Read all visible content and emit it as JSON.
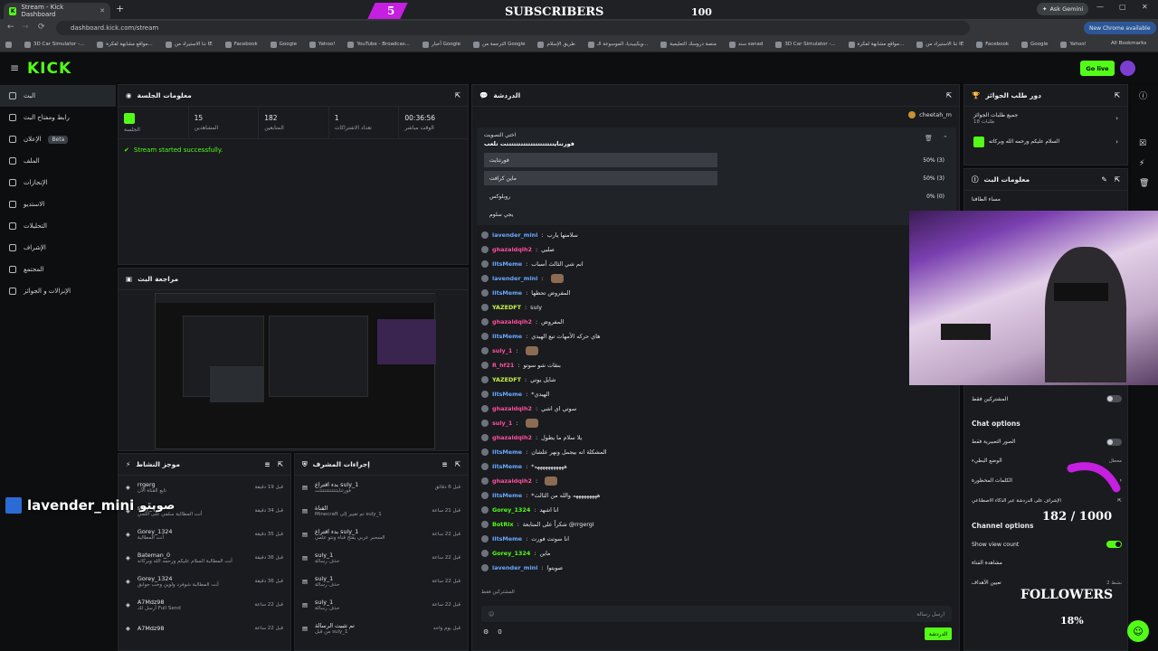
{
  "browser": {
    "tab_title": "Stream - Kick Dashboard",
    "new_tab": "+",
    "url": "dashboard.kick.com/stream",
    "ask_gemini": "Ask Gemini",
    "new_chrome": "New Chrome available",
    "all_bookmarks": "All Bookmarks",
    "bookmarks": [
      "3D Car Simulator -...",
      "مواقع مشابهة لفكرة...",
      "تنا الاستيراد من IE",
      "Facebook",
      "Google",
      "Yahoo!",
      "YouTube - Broadcas...",
      "أخبار Google",
      "الترجمة من Google",
      "طريق الإسلام",
      "ويكيبيديا، الموسوعة الـ...",
      "منصة دروسك التعليمية",
      "سند sanad",
      "3D Car Simulator -...",
      "مواقع مشابهة لفكرة...",
      "تنا الاستيراد من IE",
      "Facebook",
      "Google",
      "Yahoo!"
    ]
  },
  "overlay": {
    "subs_count": "5",
    "subs_label": "SUBSCRIBERS",
    "subs_goal": "100",
    "followers_count": "182 / 1000",
    "followers_label": "FOLLOWERS",
    "followers_pct": "18%",
    "highlight_user": "lavender_mini",
    "highlight_text": "صوبتو"
  },
  "header": {
    "logo": "KICK",
    "golive": "Go live"
  },
  "sidebar": {
    "items": [
      {
        "label": "البث",
        "badge": ""
      },
      {
        "label": "رابط ومفتاح البث",
        "badge": ""
      },
      {
        "label": "الإعلان",
        "badge": "Beta"
      },
      {
        "label": "الملف",
        "badge": ""
      },
      {
        "label": "الإنجازات",
        "badge": ""
      },
      {
        "label": "الاستديو",
        "badge": ""
      },
      {
        "label": "التحليلات",
        "badge": ""
      },
      {
        "label": "الإشراف",
        "badge": ""
      },
      {
        "label": "المجتمع",
        "badge": ""
      },
      {
        "label": "الإنزالات و الجوائز",
        "badge": ""
      }
    ]
  },
  "session": {
    "title": "معلومات الجلسة",
    "stats": [
      {
        "value": "",
        "label": "الجلسة"
      },
      {
        "value": "15",
        "label": "المشاهدين"
      },
      {
        "value": "182",
        "label": "المتابعين"
      },
      {
        "value": "1",
        "label": "تعداد الاشتراكات"
      },
      {
        "value": "00:36:56",
        "label": "الوقت مباشر"
      }
    ],
    "status": "Stream started successfully."
  },
  "preview": {
    "title": "مراجعة البث"
  },
  "activity": {
    "title": "موجز النشاط",
    "rows": [
      {
        "user": "rrgerg",
        "line1": "تابع القناة الآن",
        "time": "قبل 19 دقيقة"
      },
      {
        "user": "suly_1",
        "line1": "أنت المطالبة سلمي على اللجي",
        "time": "قبل 34 دقيقة"
      },
      {
        "user": "Gorey_1324",
        "line1": "أنت المطالبة",
        "time": "قبل 35 دقيقة"
      },
      {
        "user": "Bateman_0",
        "line1": "أنت المطالبة السلام عليكم ورحمه الله وبركاته",
        "time": "قبل 36 دقيقة"
      },
      {
        "user": "Gorey_1324",
        "line1": "أنت المطالبة شوفرد ولوين وحب حوابق",
        "time": "قبل 36 دقيقة"
      },
      {
        "user": "A7Mdz98",
        "line1": "أرسل لك Full Send",
        "time": "قبل 22 ساعة"
      },
      {
        "user": "A7Mdz98",
        "line1": "",
        "time": "قبل 22 ساعة"
      }
    ],
    "coin": "100"
  },
  "modlog": {
    "title": "إجراءات المشرف",
    "rows": [
      {
        "title": "بدء اقتراع suly_1",
        "sub": "فورتنايتتتتتتتتتتتتت",
        "time": "قبل 6 دقائق"
      },
      {
        "title": "القناة",
        "sub": "Minecraft تم تغيير إلى suly_1",
        "time": "قبل 21 ساعة"
      },
      {
        "title": "بدء اقتراع suly_1",
        "sub": "السحبر عربي يفتح قناة ونتو علمي",
        "time": "قبل 22 ساعة"
      },
      {
        "title": "suly_1",
        "sub": "حذف رسالة",
        "time": "قبل 22 ساعة"
      },
      {
        "title": "suly_1",
        "sub": "حذف رسالة",
        "time": "قبل 22 ساعة"
      },
      {
        "title": "suly_1",
        "sub": "حذف رسالة",
        "time": "قبل 22 ساعة"
      },
      {
        "title": "تم تثبيت الرسالة",
        "sub": "من قبل suly_1",
        "time": "قبل يوم واحد"
      }
    ]
  },
  "chat": {
    "title": "الدردشة",
    "pinned_user": "cheetah_m",
    "poll": {
      "title": "اختي التصويت",
      "question": "فورتنايتتتتتتتتتتتتتتتتتتتتت تلعب",
      "options": [
        {
          "label": "فورتنايت",
          "pct": "50% (3)",
          "fill": 0.5
        },
        {
          "label": "ماين كرافت",
          "pct": "50% (3)",
          "fill": 0.5
        },
        {
          "label": "روبلوكس",
          "pct": "0% (0)",
          "fill": 0
        },
        {
          "label": "يجي سلوم",
          "pct": "",
          "fill": 0
        }
      ]
    },
    "messages": [
      {
        "user": "lavender_mini",
        "color": "bl",
        "text": "سلامتها يارب"
      },
      {
        "user": "ghazaldqih2",
        "color": "pk",
        "text": "صلبي"
      },
      {
        "user": "IltsMeme",
        "color": "bl",
        "text": "انم شي الثالث أسباب"
      },
      {
        "user": "lavender_mini",
        "color": "bl",
        "text": ""
      },
      {
        "user": "IltsMeme",
        "color": "bl",
        "text": "المفروض تحطها"
      },
      {
        "user": "YAZEDFT",
        "color": "yl",
        "text": "suly"
      },
      {
        "user": "ghazaldqih2",
        "color": "pk",
        "text": "المفروض"
      },
      {
        "user": "IltsMeme",
        "color": "bl",
        "text": "هاي حركه الأمهات تبع الهيدي"
      },
      {
        "user": "suly_1",
        "color": "pk",
        "text": ""
      },
      {
        "user": "R_hf21",
        "color": "pk",
        "text": "بنقات شو سوتو"
      },
      {
        "user": "YAZEDFT",
        "color": "yl",
        "text": "شايل يوتي"
      },
      {
        "user": "IltsMeme",
        "color": "bl",
        "text": "*الهيدي"
      },
      {
        "user": "ghazaldqih2",
        "color": "pk",
        "text": "سوتي اي اشي"
      },
      {
        "user": "suly_1",
        "color": "pk",
        "text": ""
      },
      {
        "user": "ghazaldqih2",
        "color": "pk",
        "text": "يلا سلام ما يطول"
      },
      {
        "user": "IltsMeme",
        "color": "bl",
        "text": "المشكلة انه بيجمل ونهر علشان"
      },
      {
        "user": "IltsMeme",
        "color": "bl",
        "text": "*هههههههههههه"
      },
      {
        "user": "ghazaldqih2",
        "color": "pk",
        "text": ""
      },
      {
        "user": "IltsMeme",
        "color": "bl",
        "text": "*هههههههههه والله من الثالث"
      },
      {
        "user": "Gorey_1324",
        "color": "gr",
        "text": "انا اشهد"
      },
      {
        "user": "BotRix",
        "color": "gr",
        "text": "شكراً على المتابعة @rrgergl"
      },
      {
        "user": "IltsMeme",
        "color": "bl",
        "text": "انا سوتت فورت"
      },
      {
        "user": "Gorey_1324",
        "color": "gr",
        "text": "ماين"
      },
      {
        "user": "lavender_mini",
        "color": "bl",
        "text": "صوبتوا"
      }
    ],
    "input_placeholder": "ارسل رسالة",
    "count": "0",
    "send": "الدردشة",
    "emote_label": "المشتركين فقط"
  },
  "rightcol": {
    "rewards_title": "دور طلب الجوائز",
    "reward1": "جميع طلبات الجوائز",
    "reward1_sub": "طلبات 18",
    "reward2": "السلام عليكم ورحمه الله وبركاته",
    "stream_info": "معلومات البث",
    "stream_name": "مساء الطافنا",
    "subs_only": "المشتركين فقط",
    "chat_options": "Chat options",
    "emotes_only": "الصور التعبيرية فقط",
    "slow_mode": "الوضع البطيء",
    "slow_val": "معطل",
    "banned_words": "الكلمات المحظورة",
    "ai_mod": "الإشراف على الدردشة عبر الذكاء الاصطناعي",
    "channel_options": "Channel options",
    "show_view_count": "Show view count",
    "share": "مشاهدة القناة",
    "goals": "تعيين الأهداف",
    "goals_val": "نشط 2"
  }
}
